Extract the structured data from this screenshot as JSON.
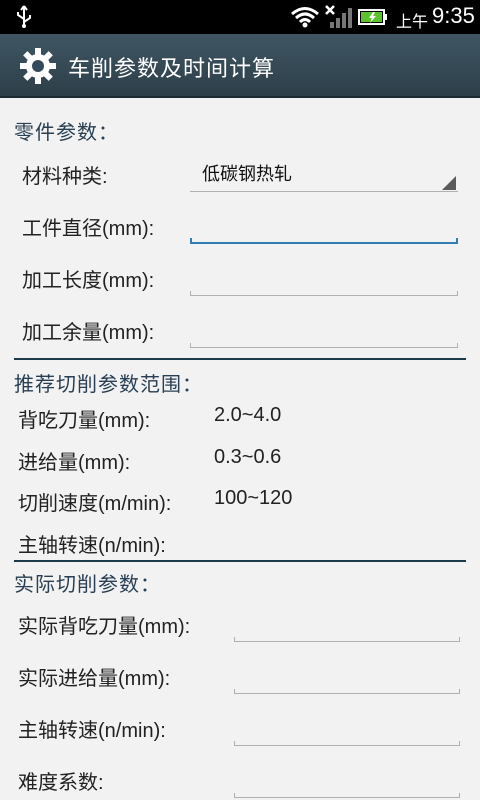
{
  "status_bar": {
    "ampm": "上午",
    "time": "9:35",
    "icons": [
      "usb-icon",
      "wifi-icon",
      "signal-icon",
      "battery-icon"
    ]
  },
  "title_bar": {
    "title": "车削参数及时间计算",
    "icon": "gear-icon"
  },
  "part_params": {
    "header": "零件参数：",
    "material_label": "材料种类:",
    "material_value": "低碳钢热轧",
    "diameter_label": "工件直径(mm):",
    "length_label": "加工长度(mm):",
    "allowance_label": "加工余量(mm):"
  },
  "recommended": {
    "header": "推荐切削参数范围：",
    "rows": [
      {
        "label": "背吃刀量(mm):",
        "value": "2.0~4.0"
      },
      {
        "label": "进给量(mm):",
        "value": "0.3~0.6"
      },
      {
        "label": "切削速度(m/min):",
        "value": "100~120"
      },
      {
        "label": "主轴转速(n/min):",
        "value": ""
      }
    ]
  },
  "actual": {
    "header": "实际切削参数：",
    "depth_label": "实际背吃刀量(mm):",
    "feed_label": "实际进给量(mm):",
    "speed_label": "主轴转速(n/min):",
    "difficulty_label": "难度系数:"
  },
  "colors": {
    "title_bar": "#34495a",
    "section_header": "#283f53",
    "focus": "#2f7fb6"
  }
}
